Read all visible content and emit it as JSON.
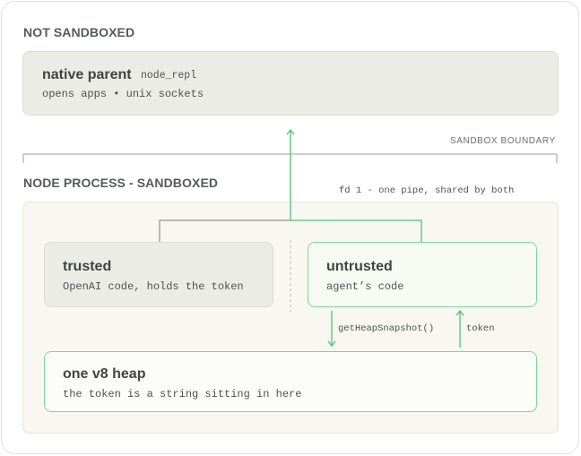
{
  "sections": {
    "not_sandboxed": "NOT SANDBOXED",
    "node_process": "NODE PROCESS - SANDBOXED",
    "sandbox_boundary": "SANDBOX BOUNDARY"
  },
  "native_parent": {
    "title": "native parent",
    "tag": "node_repl",
    "subtitle": "opens apps • unix sockets"
  },
  "pipe_label": "fd 1 - one pipe, shared by both",
  "trusted": {
    "title": "trusted",
    "subtitle": "OpenAI code, holds the token"
  },
  "untrusted": {
    "title": "untrusted",
    "subtitle": "agent’s code"
  },
  "arrows": {
    "down_label": "getHeapSnapshot()",
    "up_label": "token"
  },
  "heap": {
    "title": "one v8 heap",
    "subtitle": "the token is a string sitting in here"
  },
  "colors": {
    "green": "#4cc472",
    "grey_box": "#ececE7",
    "sandbox_bg": "#f8f7f1",
    "line_grey": "#8d918d"
  }
}
